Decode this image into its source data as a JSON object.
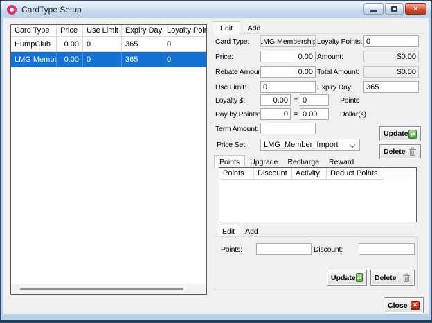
{
  "window": {
    "title": "CardType Setup"
  },
  "left_grid": {
    "columns": [
      "Card Type",
      "Price",
      "Use Limit",
      "Expiry Day",
      "Loyalty Points"
    ],
    "rows": [
      {
        "cells": [
          "HumpClub",
          "0.00",
          "0",
          "365",
          "0"
        ]
      },
      {
        "cells": [
          "LMG Member...",
          "0.00",
          "0",
          "365",
          "0"
        ]
      }
    ]
  },
  "main_tabs": {
    "edit": "Edit",
    "add": "Add"
  },
  "form": {
    "card_type_label": "Card Type:",
    "card_type_value": "LMG Membership",
    "loyalty_points_label": "Loyalty Points:",
    "loyalty_points_value": "0",
    "price_label": "Price:",
    "price_value": "0.00",
    "amount_label": "Amount:",
    "amount_value": "$0.00",
    "rebate_label": "Rebate Amount:",
    "rebate_value": "0.00",
    "total_label": "Total Amount:",
    "total_value": "$0.00",
    "use_limit_label": "Use Limit:",
    "use_limit_value": "0",
    "expiry_label": "Expiry Day:",
    "expiry_value": "365",
    "loyalty_dollar_label": "Loyalty $:",
    "loyalty_dollar_value": "0.00",
    "loyalty_dollar_eq": "=",
    "loyalty_dollar_points": "0",
    "loyalty_dollar_suffix": "Points",
    "pay_points_label": "Pay by Points:",
    "pay_points_value": "0",
    "pay_points_eq": "=",
    "pay_points_dollars": "0.00",
    "pay_points_suffix": "Dollar(s)",
    "term_label": "Term Amount:",
    "term_value": "",
    "price_set_label": "Price Set:",
    "price_set_value": "LMG_Member_Import"
  },
  "actions": {
    "update": "Update",
    "delete": "Delete",
    "close": "Close"
  },
  "points_section": {
    "tabs": {
      "points": "Points",
      "upgrade": "Upgrade",
      "recharge": "Recharge",
      "reward": "Reward"
    },
    "grid_columns": [
      "Points",
      "Discount",
      "Activity",
      "Deduct Points"
    ],
    "editor_tabs": {
      "edit": "Edit",
      "add": "Add"
    },
    "points_label": "Points:",
    "points_value": "",
    "discount_label": "Discount:",
    "discount_value": "",
    "update": "Update",
    "delete": "Delete"
  },
  "colors": {
    "selection_blue": "#1571d3",
    "update_icon_green": "#4d9e3c",
    "close_icon_red": "#a8250f",
    "title_icon_ring": "#d6336c"
  }
}
